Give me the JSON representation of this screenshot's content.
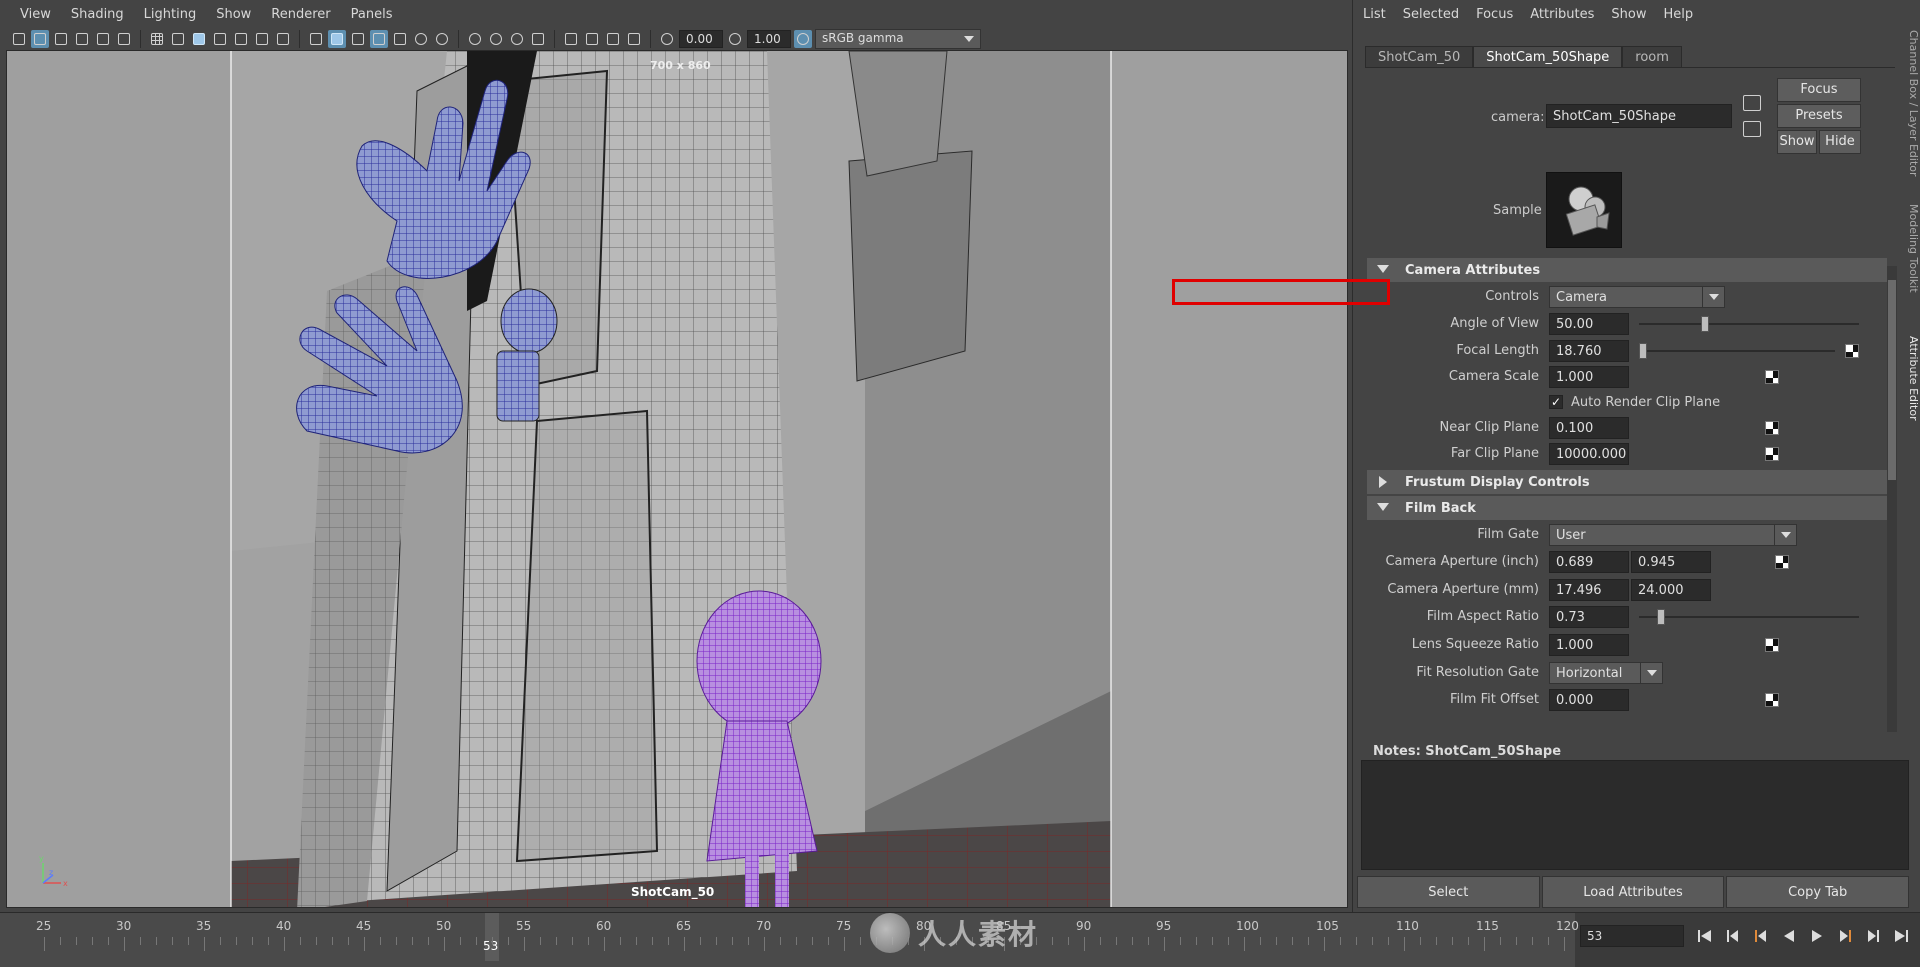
{
  "viewport": {
    "menus": [
      "View",
      "Shading",
      "Lighting",
      "Show",
      "Renderer",
      "Panels"
    ],
    "toolbar": {
      "field_a": "0.00",
      "field_b": "1.00",
      "color_space": "sRGB gamma"
    },
    "resolution": "700 x 860",
    "camera_name": "ShotCam_50"
  },
  "attribute_editor": {
    "menus": [
      "List",
      "Selected",
      "Focus",
      "Attributes",
      "Show",
      "Help"
    ],
    "tabs": [
      "ShotCam_50",
      "ShotCam_50Shape",
      "room"
    ],
    "active_tab": "ShotCam_50Shape",
    "camera_label": "camera:",
    "camera_value": "ShotCam_50Shape",
    "buttons": {
      "focus": "Focus",
      "presets": "Presets",
      "show": "Show",
      "hide": "Hide"
    },
    "sample_label": "Sample",
    "sections": {
      "camera_attributes": "Camera Attributes",
      "frustum": "Frustum Display Controls",
      "film_back": "Film Back"
    },
    "fields": {
      "controls_label": "Controls",
      "controls_value": "Camera",
      "aov_label": "Angle of View",
      "aov_value": "50.00",
      "focal_label": "Focal Length",
      "focal_value": "18.760",
      "cam_scale_label": "Camera Scale",
      "cam_scale_value": "1.000",
      "auto_render_label": "Auto Render Clip Plane",
      "near_label": "Near Clip Plane",
      "near_value": "0.100",
      "far_label": "Far Clip Plane",
      "far_value": "10000.000",
      "film_gate_label": "Film Gate",
      "film_gate_value": "User",
      "aperture_inch_label": "Camera Aperture (inch)",
      "aperture_inch_a": "0.689",
      "aperture_inch_b": "0.945",
      "aperture_mm_label": "Camera Aperture (mm)",
      "aperture_mm_a": "17.496",
      "aperture_mm_b": "24.000",
      "aspect_label": "Film Aspect Ratio",
      "aspect_value": "0.73",
      "squeeze_label": "Lens Squeeze Ratio",
      "squeeze_value": "1.000",
      "fit_gate_label": "Fit Resolution Gate",
      "fit_gate_value": "Horizontal",
      "fit_offset_label": "Film Fit Offset",
      "fit_offset_value": "0.000"
    },
    "sliders": {
      "aov": 0.3,
      "focal": 0.02,
      "aspect": 0.1
    },
    "notes_label": "Notes:  ShotCam_50Shape",
    "bottom_buttons": {
      "select": "Select",
      "load": "Load Attributes",
      "copy": "Copy Tab"
    }
  },
  "side_tabs": [
    "Channel Box / Layer Editor",
    "Modeling Toolkit",
    "Attribute Editor"
  ],
  "timeline": {
    "ticks": [
      "25",
      "30",
      "35",
      "40",
      "45",
      "50",
      "55",
      "60",
      "65",
      "70",
      "75",
      "80",
      "85",
      "90",
      "95",
      "100",
      "105",
      "110",
      "115",
      "120"
    ],
    "current_frame": "53",
    "frame_field": "53",
    "watermark": "人人素材"
  }
}
